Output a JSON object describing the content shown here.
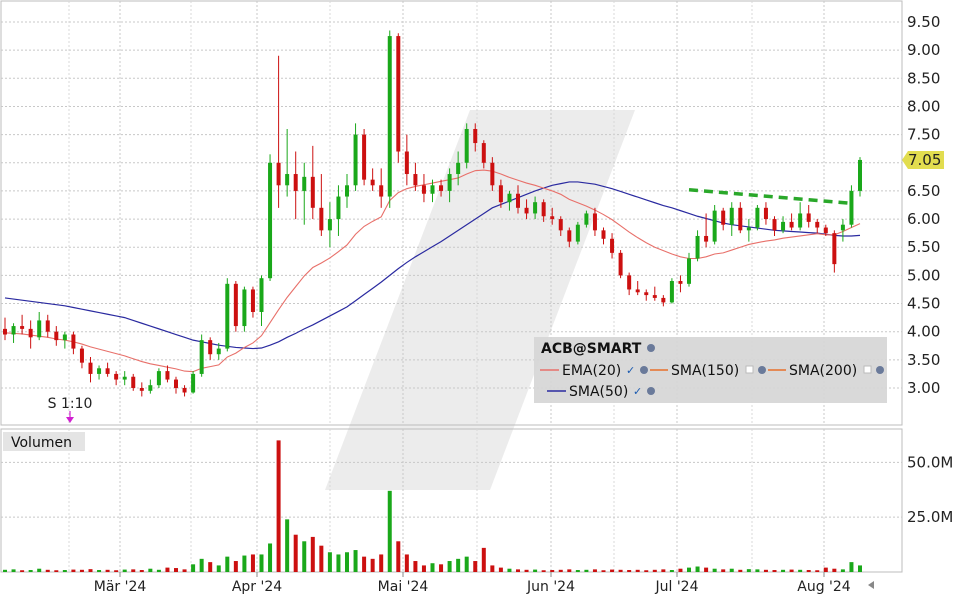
{
  "chart_data": [
    {
      "type": "candlestick",
      "symbol_label": "ACB@SMART",
      "y_ticks": [
        "9.50",
        "9.00",
        "8.50",
        "8.00",
        "7.50",
        "7.00",
        "6.50",
        "6.00",
        "5.50",
        "5.00",
        "4.50",
        "4.00",
        "3.50",
        "3.00"
      ],
      "ylim": [
        2.6,
        9.8
      ],
      "x_labels": [
        "Mär '24",
        "Apr '24",
        "Mai '24",
        "Jun '24",
        "Jul '24",
        "Aug '24"
      ],
      "last_price_label": "7.05",
      "last_price": 7.05,
      "split_marker": "S 1:10",
      "grid": true,
      "legend_position": "bottom-right",
      "legend": [
        {
          "name": "EMA(20)",
          "color": "#e8706a"
        },
        {
          "name": "SMA(150)",
          "color": "#e8702a"
        },
        {
          "name": "SMA(200)",
          "color": "#e8702a"
        },
        {
          "name": "SMA(50)",
          "color": "#2a2aa0"
        }
      ],
      "up_color": "#1aa81a",
      "down_color": "#cc1010",
      "candles": [
        [
          4.05,
          4.25,
          3.85,
          3.95
        ],
        [
          3.95,
          4.15,
          3.8,
          4.1
        ],
        [
          4.1,
          4.3,
          3.95,
          4.05
        ],
        [
          4.05,
          4.2,
          3.7,
          3.9
        ],
        [
          3.9,
          4.35,
          3.85,
          4.2
        ],
        [
          4.2,
          4.3,
          3.9,
          4.0
        ],
        [
          4.0,
          4.1,
          3.75,
          3.85
        ],
        [
          3.85,
          4.0,
          3.7,
          3.95
        ],
        [
          3.95,
          4.0,
          3.6,
          3.7
        ],
        [
          3.7,
          3.75,
          3.35,
          3.45
        ],
        [
          3.45,
          3.55,
          3.1,
          3.25
        ],
        [
          3.25,
          3.4,
          3.15,
          3.35
        ],
        [
          3.35,
          3.45,
          3.2,
          3.25
        ],
        [
          3.25,
          3.3,
          3.05,
          3.15
        ],
        [
          3.15,
          3.3,
          3.05,
          3.2
        ],
        [
          3.2,
          3.25,
          2.95,
          3.0
        ],
        [
          3.0,
          3.1,
          2.85,
          2.95
        ],
        [
          2.95,
          3.15,
          2.9,
          3.05
        ],
        [
          3.05,
          3.35,
          3.0,
          3.3
        ],
        [
          3.3,
          3.4,
          3.1,
          3.15
        ],
        [
          3.15,
          3.2,
          2.9,
          3.0
        ],
        [
          3.0,
          3.05,
          2.85,
          2.92
        ],
        [
          2.92,
          3.3,
          2.9,
          3.25
        ],
        [
          3.25,
          3.95,
          3.2,
          3.85
        ],
        [
          3.85,
          3.9,
          3.5,
          3.6
        ],
        [
          3.6,
          3.8,
          3.5,
          3.7
        ],
        [
          3.7,
          4.95,
          3.65,
          4.85
        ],
        [
          4.85,
          4.9,
          4.0,
          4.1
        ],
        [
          4.1,
          4.8,
          4.0,
          4.75
        ],
        [
          4.75,
          4.8,
          4.25,
          4.35
        ],
        [
          4.35,
          5.0,
          4.1,
          4.95
        ],
        [
          4.95,
          7.15,
          4.9,
          7.0
        ],
        [
          7.0,
          8.9,
          6.2,
          6.6
        ],
        [
          6.6,
          7.6,
          6.4,
          6.8
        ],
        [
          6.8,
          7.2,
          6.0,
          6.5
        ],
        [
          6.5,
          7.0,
          5.9,
          6.75
        ],
        [
          6.75,
          7.3,
          6.0,
          6.2
        ],
        [
          6.2,
          6.8,
          5.7,
          5.8
        ],
        [
          5.8,
          6.3,
          5.5,
          6.0
        ],
        [
          6.0,
          6.6,
          5.7,
          6.4
        ],
        [
          6.4,
          6.8,
          6.2,
          6.6
        ],
        [
          6.6,
          7.7,
          6.5,
          7.5
        ],
        [
          7.5,
          7.6,
          6.6,
          6.7
        ],
        [
          6.7,
          6.9,
          6.5,
          6.6
        ],
        [
          6.6,
          6.9,
          6.2,
          6.4
        ],
        [
          6.4,
          9.35,
          6.2,
          9.25
        ],
        [
          9.25,
          9.3,
          7.0,
          7.2
        ],
        [
          7.2,
          7.5,
          6.6,
          6.8
        ],
        [
          6.8,
          7.0,
          6.5,
          6.6
        ],
        [
          6.6,
          6.8,
          6.3,
          6.45
        ],
        [
          6.45,
          6.7,
          6.3,
          6.6
        ],
        [
          6.6,
          6.7,
          6.4,
          6.5
        ],
        [
          6.5,
          6.9,
          6.3,
          6.8
        ],
        [
          6.8,
          7.2,
          6.6,
          7.0
        ],
        [
          7.0,
          7.7,
          6.9,
          7.6
        ],
        [
          7.6,
          7.7,
          7.2,
          7.35
        ],
        [
          7.35,
          7.4,
          6.9,
          7.0
        ],
        [
          7.0,
          7.1,
          6.5,
          6.6
        ],
        [
          6.6,
          6.7,
          6.2,
          6.3
        ],
        [
          6.3,
          6.5,
          6.15,
          6.45
        ],
        [
          6.45,
          6.6,
          6.1,
          6.2
        ],
        [
          6.2,
          6.35,
          6.0,
          6.1
        ],
        [
          6.1,
          6.4,
          6.0,
          6.3
        ],
        [
          6.3,
          6.35,
          5.95,
          6.05
        ],
        [
          6.05,
          6.2,
          5.9,
          6.0
        ],
        [
          6.0,
          6.05,
          5.7,
          5.8
        ],
        [
          5.8,
          5.85,
          5.5,
          5.6
        ],
        [
          5.6,
          5.95,
          5.55,
          5.9
        ],
        [
          5.9,
          6.15,
          5.85,
          6.1
        ],
        [
          6.1,
          6.2,
          5.7,
          5.8
        ],
        [
          5.8,
          5.85,
          5.55,
          5.65
        ],
        [
          5.65,
          5.75,
          5.3,
          5.4
        ],
        [
          5.4,
          5.45,
          4.95,
          5.0
        ],
        [
          5.0,
          5.05,
          4.65,
          4.75
        ],
        [
          4.75,
          4.9,
          4.65,
          4.7
        ],
        [
          4.7,
          4.75,
          4.55,
          4.65
        ],
        [
          4.65,
          4.8,
          4.55,
          4.6
        ],
        [
          4.6,
          4.65,
          4.45,
          4.52
        ],
        [
          4.52,
          4.95,
          4.5,
          4.9
        ],
        [
          4.9,
          5.0,
          4.7,
          4.85
        ],
        [
          4.85,
          5.4,
          4.8,
          5.3
        ],
        [
          5.3,
          5.8,
          5.25,
          5.7
        ],
        [
          5.7,
          6.1,
          5.5,
          5.6
        ],
        [
          5.6,
          6.25,
          5.55,
          6.15
        ],
        [
          6.15,
          6.2,
          5.8,
          5.9
        ],
        [
          5.9,
          6.3,
          5.7,
          6.2
        ],
        [
          6.2,
          6.3,
          5.75,
          5.8
        ],
        [
          5.8,
          6.0,
          5.6,
          5.85
        ],
        [
          5.85,
          6.25,
          5.8,
          6.2
        ],
        [
          6.2,
          6.3,
          5.9,
          6.0
        ],
        [
          6.0,
          6.05,
          5.7,
          5.8
        ],
        [
          5.8,
          6.05,
          5.75,
          5.95
        ],
        [
          5.95,
          6.1,
          5.8,
          5.85
        ],
        [
          5.85,
          6.3,
          5.8,
          6.1
        ],
        [
          6.1,
          6.25,
          5.85,
          5.95
        ],
        [
          5.95,
          6.0,
          5.75,
          5.85
        ],
        [
          5.85,
          5.9,
          5.7,
          5.75
        ],
        [
          5.75,
          5.8,
          5.05,
          5.2
        ],
        [
          5.8,
          6.0,
          5.6,
          5.9
        ],
        [
          5.9,
          6.6,
          5.85,
          6.5
        ],
        [
          6.5,
          7.1,
          6.4,
          7.05
        ]
      ],
      "ema20": [
        3.98,
        3.97,
        3.96,
        3.94,
        3.92,
        3.9,
        3.87,
        3.85,
        3.82,
        3.78,
        3.73,
        3.69,
        3.65,
        3.61,
        3.57,
        3.52,
        3.47,
        3.43,
        3.4,
        3.37,
        3.34,
        3.3,
        3.29,
        3.35,
        3.38,
        3.41,
        3.55,
        3.62,
        3.72,
        3.8,
        3.93,
        4.16,
        4.39,
        4.61,
        4.8,
        4.99,
        5.14,
        5.22,
        5.31,
        5.42,
        5.54,
        5.73,
        5.87,
        5.96,
        6.04,
        6.33,
        6.47,
        6.54,
        6.58,
        6.61,
        6.64,
        6.67,
        6.7,
        6.73,
        6.8,
        6.86,
        6.87,
        6.85,
        6.8,
        6.74,
        6.69,
        6.64,
        6.6,
        6.55,
        6.5,
        6.44,
        6.35,
        6.29,
        6.23,
        6.16,
        6.08,
        5.99,
        5.88,
        5.77,
        5.67,
        5.58,
        5.5,
        5.44,
        5.38,
        5.33,
        5.3,
        5.3,
        5.33,
        5.38,
        5.4,
        5.45,
        5.5,
        5.55,
        5.58,
        5.61,
        5.63,
        5.66,
        5.68,
        5.7,
        5.72,
        5.74,
        5.72,
        5.72,
        5.78,
        5.85,
        5.92
      ],
      "sma50": [
        4.6,
        4.58,
        4.56,
        4.54,
        4.52,
        4.5,
        4.48,
        4.46,
        4.43,
        4.4,
        4.37,
        4.34,
        4.31,
        4.28,
        4.25,
        4.2,
        4.15,
        4.1,
        4.05,
        4.0,
        3.95,
        3.9,
        3.85,
        3.82,
        3.79,
        3.76,
        3.74,
        3.72,
        3.71,
        3.7,
        3.71,
        3.76,
        3.82,
        3.9,
        3.97,
        4.05,
        4.12,
        4.2,
        4.28,
        4.36,
        4.44,
        4.55,
        4.66,
        4.77,
        4.88,
        5.0,
        5.12,
        5.23,
        5.33,
        5.42,
        5.51,
        5.6,
        5.7,
        5.8,
        5.9,
        6.0,
        6.1,
        6.2,
        6.26,
        6.32,
        6.38,
        6.44,
        6.5,
        6.55,
        6.6,
        6.63,
        6.66,
        6.66,
        6.64,
        6.62,
        6.58,
        6.54,
        6.49,
        6.44,
        6.39,
        6.34,
        6.29,
        6.24,
        6.2,
        6.15,
        6.1,
        6.05,
        6.01,
        5.97,
        5.93,
        5.9,
        5.88,
        5.86,
        5.84,
        5.82,
        5.8,
        5.79,
        5.78,
        5.77,
        5.76,
        5.75,
        5.73,
        5.71,
        5.7,
        5.7,
        5.71
      ],
      "trendline": {
        "x0": 80,
        "y0": 6.52,
        "x1": 99,
        "y1": 6.28
      }
    },
    {
      "type": "bar",
      "panel_label": "Volumen",
      "y_ticks": [
        "50.0M",
        "25.0M"
      ],
      "ylim": [
        0,
        62
      ],
      "values": [
        1.0,
        1.2,
        0.8,
        0.9,
        1.5,
        1.0,
        0.8,
        0.9,
        1.1,
        1.0,
        1.3,
        0.9,
        1.0,
        0.8,
        1.1,
        1.2,
        0.9,
        1.5,
        1.0,
        2.0,
        1.8,
        1.2,
        3.5,
        6.0,
        4.5,
        3.0,
        7.0,
        5.0,
        7.5,
        8.0,
        8.0,
        13.0,
        60.0,
        24.0,
        17.0,
        14.0,
        16.0,
        12.0,
        9.0,
        8.0,
        9.0,
        10.0,
        7.0,
        6.0,
        8.0,
        37.0,
        14.0,
        8.0,
        5.0,
        3.0,
        4.0,
        3.5,
        5.0,
        6.0,
        7.0,
        5.0,
        11.0,
        3.0,
        2.0,
        1.5,
        1.2,
        1.0,
        1.1,
        0.8,
        0.9,
        1.0,
        1.2,
        0.9,
        1.0,
        1.2,
        0.8,
        1.1,
        1.0,
        0.9,
        1.0,
        0.8,
        1.0,
        1.2,
        0.9,
        1.5,
        2.0,
        2.5,
        2.0,
        1.5,
        1.2,
        1.5,
        1.0,
        1.3,
        1.2,
        1.0,
        0.9,
        1.0,
        1.1,
        1.0,
        0.9,
        0.8,
        2.0,
        1.5,
        1.2,
        4.5,
        3.0
      ],
      "up": [
        1,
        1,
        0,
        1,
        1,
        0,
        0,
        1,
        0,
        0,
        0,
        1,
        0,
        0,
        1,
        0,
        0,
        1,
        1,
        0,
        0,
        0,
        1,
        1,
        0,
        1,
        1,
        0,
        1,
        0,
        1,
        1,
        0,
        1,
        0,
        1,
        0,
        0,
        1,
        1,
        1,
        1,
        0,
        0,
        0,
        1,
        0,
        0,
        0,
        0,
        1,
        0,
        1,
        1,
        1,
        0,
        0,
        0,
        0,
        1,
        0,
        0,
        1,
        0,
        0,
        0,
        0,
        1,
        1,
        0,
        0,
        0,
        0,
        0,
        0,
        0,
        0,
        0,
        1,
        0,
        1,
        1,
        0,
        1,
        0,
        1,
        0,
        1,
        1,
        0,
        0,
        1,
        0,
        1,
        0,
        0,
        0,
        0,
        1,
        1,
        1
      ]
    }
  ]
}
